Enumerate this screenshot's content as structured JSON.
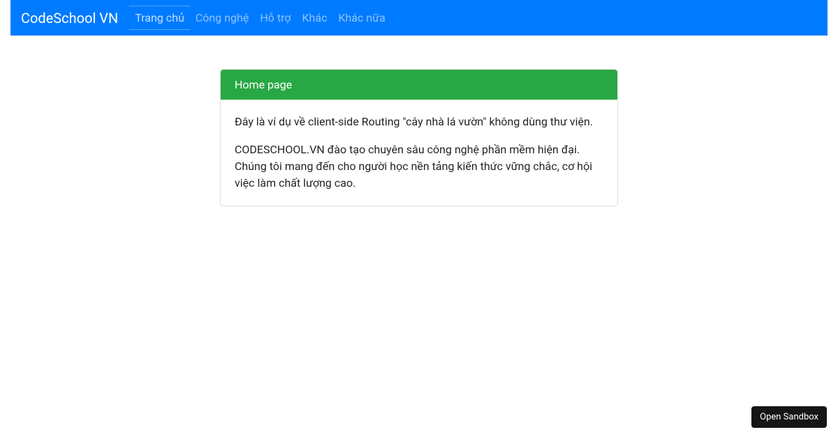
{
  "navbar": {
    "brand": "CodeSchool VN",
    "items": [
      {
        "label": "Trang chủ",
        "active": true
      },
      {
        "label": "Công nghệ",
        "active": false
      },
      {
        "label": "Hỗ trợ",
        "active": false
      },
      {
        "label": "Khác",
        "active": false
      },
      {
        "label": "Khác nữa",
        "active": false
      }
    ]
  },
  "card": {
    "header": "Home page",
    "p1": "Đây là ví dụ về client-side Routing \"cây nhà lá vườn\" không dùng thư viện.",
    "p2": "CODESCHOOL.VN đào tạo chuyên sâu công nghệ phần mềm hiện đại. Chúng tôi mang đến cho người học nền tảng kiến thức vững chắc, cơ hội việc làm chất lượng cao."
  },
  "sandbox": {
    "label": "Open Sandbox"
  },
  "colors": {
    "navbar_bg": "#007bff",
    "card_header_bg": "#28a745",
    "sandbox_bg": "#151515"
  }
}
